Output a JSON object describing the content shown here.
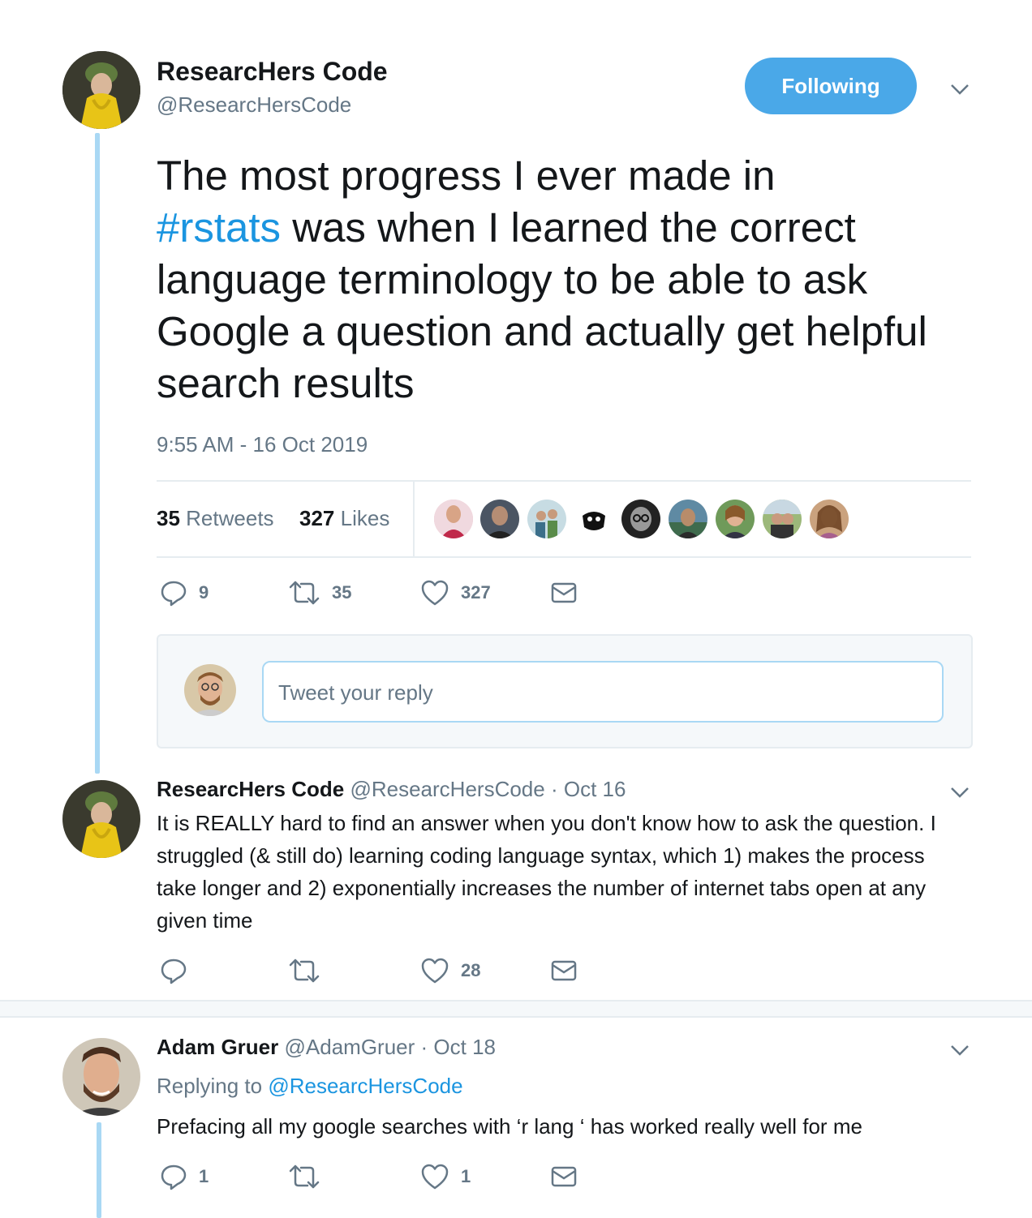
{
  "main_tweet": {
    "author_name": "ResearcHers Code",
    "author_handle": "@ResearcHersCode",
    "follow_label": "Following",
    "text_prefix": "The most progress I ever made in",
    "hashtag": "#rstats",
    "text_suffix": " was when I learned the correct language terminology to be able to ask Google a question and actually get helpful search results",
    "timestamp": "9:55 AM - 16 Oct 2019",
    "retweets_count": "35",
    "retweets_label": "Retweets",
    "likes_count": "327",
    "likes_label": "Likes",
    "replies": "9",
    "retweets": "35",
    "likes": "327"
  },
  "reply_box": {
    "placeholder": "Tweet your reply"
  },
  "reply1": {
    "author_name": "ResearcHers Code",
    "author_handle": "@ResearcHersCode",
    "date": "· Oct 16",
    "text": "It is REALLY hard to find an answer when you don't know how to ask the question. I struggled (& still do) learning coding language syntax, which 1) makes the process take longer and 2) exponentially increases the number of internet tabs open at any given time",
    "likes": "28"
  },
  "reply2": {
    "author_name": "Adam Gruer",
    "author_handle": "@AdamGruer",
    "date": "· Oct 18",
    "replying_label": "Replying to",
    "replying_handle": "@ResearcHersCode",
    "text": "Prefacing all my google searches with ‘r lang ‘ has worked really well for me",
    "replies": "1",
    "likes": "1"
  },
  "colors": {
    "accent": "#1da1f2",
    "follow_button": "#4aa8e8",
    "thread_line": "#a9d8f4",
    "muted_text": "#657786"
  }
}
